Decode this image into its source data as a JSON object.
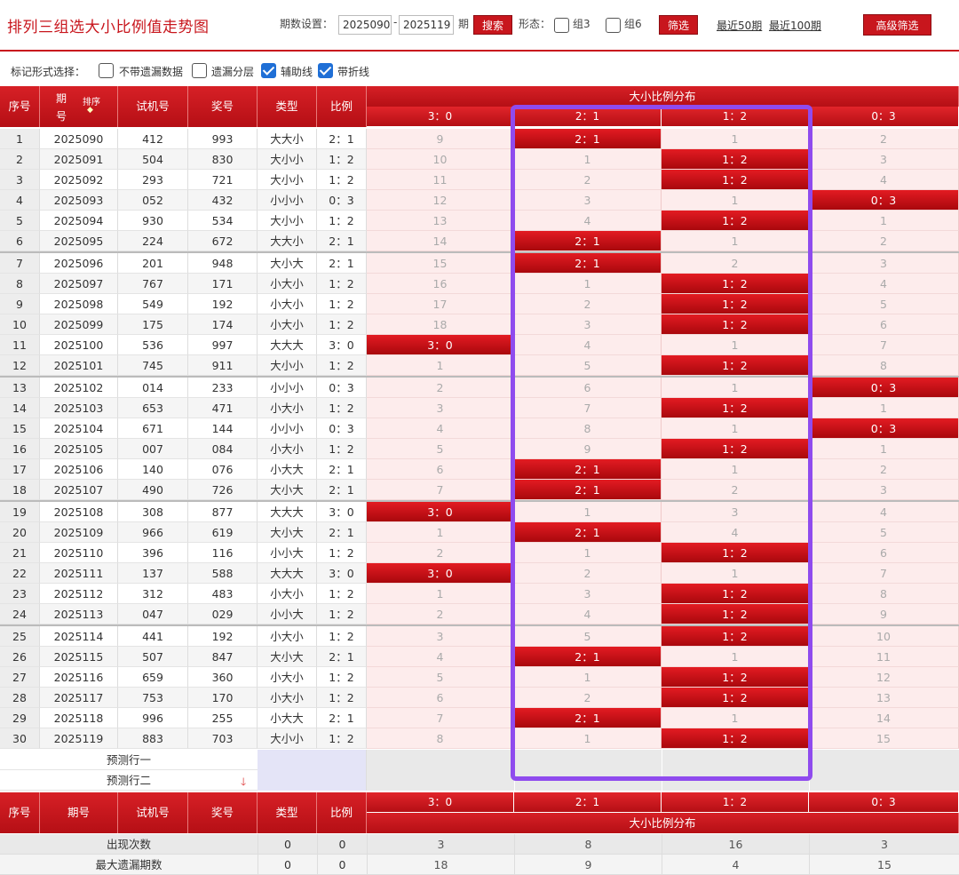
{
  "page": {
    "title": "排列三组选大小比例值走势图"
  },
  "controls": {
    "period_label": "期数设置：",
    "from": "2025090",
    "dash": "-",
    "to": "2025119",
    "period_unit": "期",
    "search": "搜索",
    "form_label": "形态：",
    "group3": "组3",
    "group6": "组6",
    "filter": "筛选",
    "last50": "最近50期",
    "last100": "最近100期",
    "advanced": "高级筛选"
  },
  "marks": {
    "label": "标记形式选择：",
    "no_miss": "不带遗漏数据",
    "miss_layer": "遗漏分层",
    "aux_line": "辅助线",
    "fold_line": "带折线",
    "checked": [
      false,
      false,
      true,
      true
    ]
  },
  "headers": {
    "seq": "序号",
    "issue": "期号",
    "issue_1": "期",
    "issue_2": "号",
    "sort": "排序",
    "trial": "试机号",
    "winning": "奖号",
    "type": "类型",
    "ratio": "比例",
    "dist": "大小比例分布",
    "cols": [
      "3：0",
      "2：1",
      "1：2",
      "0：3"
    ]
  },
  "rows": [
    {
      "seq": "1",
      "issue": "2025090",
      "trial": "412",
      "win": "993",
      "type": "大大小",
      "ratio": "2：1",
      "cells": [
        "9",
        "2：1",
        "1",
        "2"
      ],
      "hit": 1
    },
    {
      "seq": "2",
      "issue": "2025091",
      "trial": "504",
      "win": "830",
      "type": "大小小",
      "ratio": "1：2",
      "cells": [
        "10",
        "1",
        "1：2",
        "3"
      ],
      "hit": 2
    },
    {
      "seq": "3",
      "issue": "2025092",
      "trial": "293",
      "win": "721",
      "type": "大小小",
      "ratio": "1：2",
      "cells": [
        "11",
        "2",
        "1：2",
        "4"
      ],
      "hit": 2
    },
    {
      "seq": "4",
      "issue": "2025093",
      "trial": "052",
      "win": "432",
      "type": "小小小",
      "ratio": "0：3",
      "cells": [
        "12",
        "3",
        "1",
        "0：3"
      ],
      "hit": 3
    },
    {
      "seq": "5",
      "issue": "2025094",
      "trial": "930",
      "win": "534",
      "type": "大小小",
      "ratio": "1：2",
      "cells": [
        "13",
        "4",
        "1：2",
        "1"
      ],
      "hit": 2
    },
    {
      "seq": "6",
      "issue": "2025095",
      "trial": "224",
      "win": "672",
      "type": "大大小",
      "ratio": "2：1",
      "cells": [
        "14",
        "2：1",
        "1",
        "2"
      ],
      "hit": 1
    },
    {
      "seq": "7",
      "issue": "2025096",
      "trial": "201",
      "win": "948",
      "type": "大小大",
      "ratio": "2：1",
      "cells": [
        "15",
        "2：1",
        "2",
        "3"
      ],
      "hit": 1
    },
    {
      "seq": "8",
      "issue": "2025097",
      "trial": "767",
      "win": "171",
      "type": "小大小",
      "ratio": "1：2",
      "cells": [
        "16",
        "1",
        "1：2",
        "4"
      ],
      "hit": 2
    },
    {
      "seq": "9",
      "issue": "2025098",
      "trial": "549",
      "win": "192",
      "type": "小大小",
      "ratio": "1：2",
      "cells": [
        "17",
        "2",
        "1：2",
        "5"
      ],
      "hit": 2
    },
    {
      "seq": "10",
      "issue": "2025099",
      "trial": "175",
      "win": "174",
      "type": "小大小",
      "ratio": "1：2",
      "cells": [
        "18",
        "3",
        "1：2",
        "6"
      ],
      "hit": 2
    },
    {
      "seq": "11",
      "issue": "2025100",
      "trial": "536",
      "win": "997",
      "type": "大大大",
      "ratio": "3：0",
      "cells": [
        "3：0",
        "4",
        "1",
        "7"
      ],
      "hit": 0
    },
    {
      "seq": "12",
      "issue": "2025101",
      "trial": "745",
      "win": "911",
      "type": "大小小",
      "ratio": "1：2",
      "cells": [
        "1",
        "5",
        "1：2",
        "8"
      ],
      "hit": 2
    },
    {
      "seq": "13",
      "issue": "2025102",
      "trial": "014",
      "win": "233",
      "type": "小小小",
      "ratio": "0：3",
      "cells": [
        "2",
        "6",
        "1",
        "0：3"
      ],
      "hit": 3
    },
    {
      "seq": "14",
      "issue": "2025103",
      "trial": "653",
      "win": "471",
      "type": "小大小",
      "ratio": "1：2",
      "cells": [
        "3",
        "7",
        "1：2",
        "1"
      ],
      "hit": 2
    },
    {
      "seq": "15",
      "issue": "2025104",
      "trial": "671",
      "win": "144",
      "type": "小小小",
      "ratio": "0：3",
      "cells": [
        "4",
        "8",
        "1",
        "0：3"
      ],
      "hit": 3
    },
    {
      "seq": "16",
      "issue": "2025105",
      "trial": "007",
      "win": "084",
      "type": "小大小",
      "ratio": "1：2",
      "cells": [
        "5",
        "9",
        "1：2",
        "1"
      ],
      "hit": 2
    },
    {
      "seq": "17",
      "issue": "2025106",
      "trial": "140",
      "win": "076",
      "type": "小大大",
      "ratio": "2：1",
      "cells": [
        "6",
        "2：1",
        "1",
        "2"
      ],
      "hit": 1
    },
    {
      "seq": "18",
      "issue": "2025107",
      "trial": "490",
      "win": "726",
      "type": "大小大",
      "ratio": "2：1",
      "cells": [
        "7",
        "2：1",
        "2",
        "3"
      ],
      "hit": 1
    },
    {
      "seq": "19",
      "issue": "2025108",
      "trial": "308",
      "win": "877",
      "type": "大大大",
      "ratio": "3：0",
      "cells": [
        "3：0",
        "1",
        "3",
        "4"
      ],
      "hit": 0
    },
    {
      "seq": "20",
      "issue": "2025109",
      "trial": "966",
      "win": "619",
      "type": "大小大",
      "ratio": "2：1",
      "cells": [
        "1",
        "2：1",
        "4",
        "5"
      ],
      "hit": 1
    },
    {
      "seq": "21",
      "issue": "2025110",
      "trial": "396",
      "win": "116",
      "type": "小小大",
      "ratio": "1：2",
      "cells": [
        "2",
        "1",
        "1：2",
        "6"
      ],
      "hit": 2
    },
    {
      "seq": "22",
      "issue": "2025111",
      "trial": "137",
      "win": "588",
      "type": "大大大",
      "ratio": "3：0",
      "cells": [
        "3：0",
        "2",
        "1",
        "7"
      ],
      "hit": 0
    },
    {
      "seq": "23",
      "issue": "2025112",
      "trial": "312",
      "win": "483",
      "type": "小大小",
      "ratio": "1：2",
      "cells": [
        "1",
        "3",
        "1：2",
        "8"
      ],
      "hit": 2
    },
    {
      "seq": "24",
      "issue": "2025113",
      "trial": "047",
      "win": "029",
      "type": "小小大",
      "ratio": "1：2",
      "cells": [
        "2",
        "4",
        "1：2",
        "9"
      ],
      "hit": 2
    },
    {
      "seq": "25",
      "issue": "2025114",
      "trial": "441",
      "win": "192",
      "type": "小大小",
      "ratio": "1：2",
      "cells": [
        "3",
        "5",
        "1：2",
        "10"
      ],
      "hit": 2
    },
    {
      "seq": "26",
      "issue": "2025115",
      "trial": "507",
      "win": "847",
      "type": "大小大",
      "ratio": "2：1",
      "cells": [
        "4",
        "2：1",
        "1",
        "11"
      ],
      "hit": 1
    },
    {
      "seq": "27",
      "issue": "2025116",
      "trial": "659",
      "win": "360",
      "type": "小大小",
      "ratio": "1：2",
      "cells": [
        "5",
        "1",
        "1：2",
        "12"
      ],
      "hit": 2
    },
    {
      "seq": "28",
      "issue": "2025117",
      "trial": "753",
      "win": "170",
      "type": "小大小",
      "ratio": "1：2",
      "cells": [
        "6",
        "2",
        "1：2",
        "13"
      ],
      "hit": 2
    },
    {
      "seq": "29",
      "issue": "2025118",
      "trial": "996",
      "win": "255",
      "type": "小大大",
      "ratio": "2：1",
      "cells": [
        "7",
        "2：1",
        "1",
        "14"
      ],
      "hit": 1
    },
    {
      "seq": "30",
      "issue": "2025119",
      "trial": "883",
      "win": "703",
      "type": "大小小",
      "ratio": "1：2",
      "cells": [
        "8",
        "1",
        "1：2",
        "15"
      ],
      "hit": 2
    }
  ],
  "predict": {
    "row1": "预测行一",
    "row2": "预测行二"
  },
  "stats": [
    {
      "label": "出现次数",
      "type": "0",
      "ratio": "0",
      "vals": [
        "3",
        "8",
        "16",
        "3"
      ]
    },
    {
      "label": "最大遗漏期数",
      "type": "0",
      "ratio": "0",
      "vals": [
        "18",
        "9",
        "4",
        "15"
      ]
    }
  ],
  "colors": {
    "accent": "#c8161d",
    "highlight": "#8f4bee",
    "row_pink": "#fdecec"
  }
}
